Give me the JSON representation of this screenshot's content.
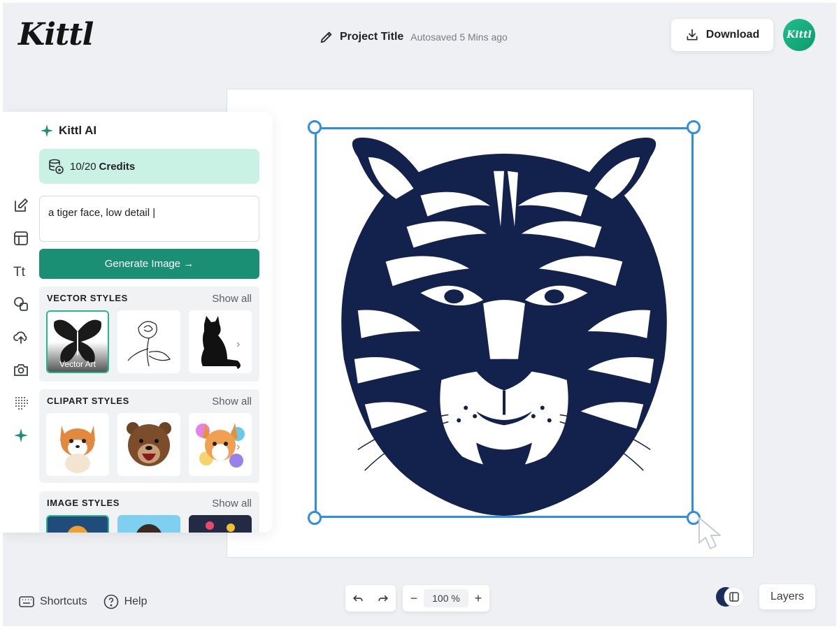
{
  "header": {
    "logo_text": "Kittl",
    "project_title": "Project Title",
    "autosave_status": "Autosaved 5 Mins ago",
    "download_label": "Download",
    "avatar_text": "Kittl",
    "icons": [
      "pencil-icon",
      "download-icon"
    ]
  },
  "sidebar": {
    "tools": [
      {
        "name": "edit-tool",
        "icon": "edit-icon"
      },
      {
        "name": "templates-tool",
        "icon": "layout-icon"
      },
      {
        "name": "text-tool",
        "icon": "text-icon",
        "glyph": "Tt"
      },
      {
        "name": "shapes-tool",
        "icon": "shapes-icon"
      },
      {
        "name": "upload-tool",
        "icon": "upload-icon"
      },
      {
        "name": "photos-tool",
        "icon": "camera-icon"
      },
      {
        "name": "patterns-tool",
        "icon": "dots-icon"
      },
      {
        "name": "ai-tool",
        "icon": "sparkle-icon",
        "active": true
      }
    ]
  },
  "ai_panel": {
    "title": "Kittl AI",
    "credits_value": "10/20",
    "credits_label": "Credits",
    "prompt_value": "a tiger face, low detail |",
    "generate_label": "Generate Image →",
    "sections": [
      {
        "title": "VECTOR STYLES",
        "show_all": "Show all",
        "items": [
          {
            "name": "butterfly-thumb",
            "label": "Vector Art",
            "selected": true
          },
          {
            "name": "rose-line-thumb",
            "label": ""
          },
          {
            "name": "cat-silhouette-thumb",
            "label": ""
          }
        ]
      },
      {
        "title": "CLIPART STYLES",
        "show_all": "Show all",
        "items": [
          {
            "name": "corgi-clipart-thumb",
            "label": ""
          },
          {
            "name": "bear-clipart-thumb",
            "label": ""
          },
          {
            "name": "splash-corgi-thumb",
            "label": ""
          }
        ]
      },
      {
        "title": "IMAGE STYLES",
        "show_all": "Show all",
        "items": [
          {
            "name": "image-style-1-thumb",
            "label": ""
          },
          {
            "name": "image-style-2-thumb",
            "label": ""
          },
          {
            "name": "image-style-3-thumb",
            "label": ""
          }
        ]
      }
    ]
  },
  "canvas": {
    "image_subject": "tiger-face-vector",
    "accent_color": "#2f8ee3",
    "ink_color": "#13214d"
  },
  "bottom_bar": {
    "shortcuts_label": "Shortcuts",
    "help_label": "Help",
    "zoom_value": "100 %",
    "zoom_minus": "−",
    "zoom_plus": "+",
    "layers_label": "Layers"
  },
  "colors": {
    "brand_green": "#1a8f74",
    "credits_bg": "#c9f2e5",
    "background": "#eef0f3"
  }
}
